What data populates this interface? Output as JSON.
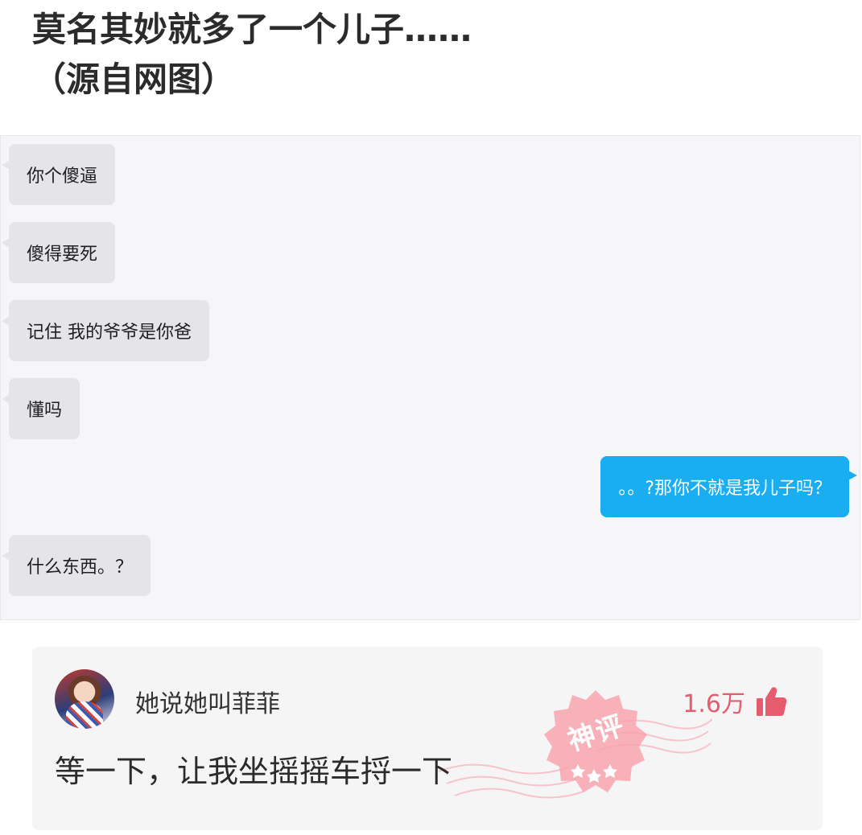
{
  "post": {
    "title_line1": "莫名其妙就多了一个儿子……",
    "title_line2": "（源自网图）"
  },
  "chat": {
    "messages": [
      {
        "side": "left",
        "text": "你个傻逼"
      },
      {
        "side": "left",
        "text": "傻得要死"
      },
      {
        "side": "left",
        "text": "记住 我的爷爷是你爸"
      },
      {
        "side": "left",
        "text": "懂吗"
      },
      {
        "side": "right",
        "text": "。。?那你不就是我儿子吗？"
      },
      {
        "side": "left",
        "text": "什么东西。？"
      }
    ]
  },
  "comment": {
    "username": "她说她叫菲菲",
    "likes": "1.6万",
    "text": "等一下，让我坐摇摇车捋一下",
    "badge": "神评",
    "like_icon": "thumbs-up-icon",
    "accent_color": "#e75b6f",
    "badge_color": "#f8a3ae"
  },
  "colors": {
    "sent_bubble": "#1aaef0",
    "received_bubble": "#e4e4e9"
  }
}
